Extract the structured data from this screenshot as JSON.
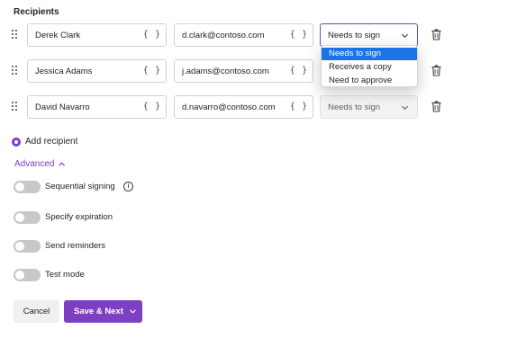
{
  "section_title": "Recipients",
  "recipients": [
    {
      "name": "Derek Clark",
      "email": "d.clark@contoso.com",
      "role": "Needs to sign"
    },
    {
      "name": "Jessica Adams",
      "email": "j.adams@contoso.com",
      "role": "Needs to sign"
    },
    {
      "name": "David Navarro",
      "email": "d.navarro@contoso.com",
      "role": "Needs to sign"
    }
  ],
  "field_token": "{ }",
  "role_dropdown": {
    "options": [
      "Needs to sign",
      "Receives a copy",
      "Need to approve"
    ],
    "selected": "Needs to sign"
  },
  "add_recipient_label": "Add recipient",
  "advanced_label": "Advanced",
  "toggles": [
    {
      "label": "Sequential signing",
      "on": false,
      "has_info": true
    },
    {
      "label": "Specify expiration",
      "on": false
    },
    {
      "label": "Send reminders",
      "on": false
    },
    {
      "label": "Test mode",
      "on": false
    }
  ],
  "info_icon_glyph": "i",
  "buttons": {
    "cancel": "Cancel",
    "save_next": "Save & Next"
  },
  "colors": {
    "accent": "#7e3fc4",
    "selected_option": "#1a73e8",
    "toggle_off": "#c8c8c8"
  },
  "icons": [
    "drag-handle-icon",
    "trash-icon",
    "chevron-down-icon",
    "chevron-up-icon",
    "info-icon",
    "add-circle-icon"
  ]
}
